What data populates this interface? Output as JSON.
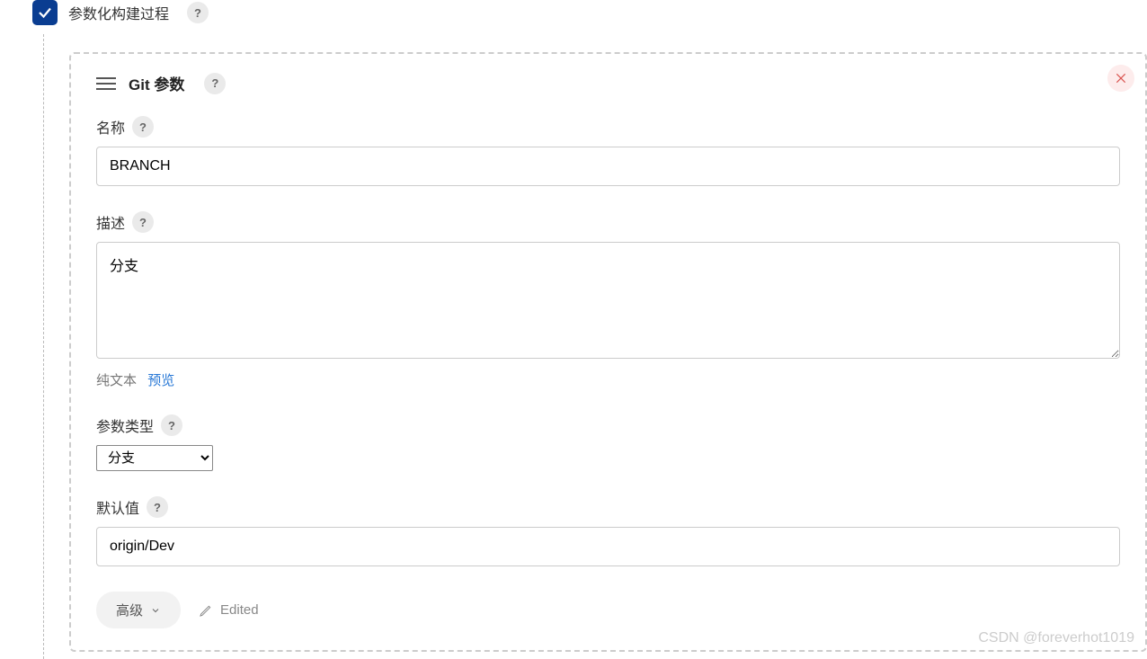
{
  "top_checkbox": {
    "label": "参数化构建过程"
  },
  "block": {
    "title": "Git 参数",
    "name_label": "名称",
    "name_value": "BRANCH",
    "desc_label": "描述",
    "desc_value": "分支",
    "desc_links": {
      "plaintext": "纯文本",
      "preview": "预览"
    },
    "param_type_label": "参数类型",
    "param_type_value": "分支",
    "default_label": "默认值",
    "default_value": "origin/Dev",
    "advanced_label": "高级",
    "edited_label": "Edited"
  },
  "watermark": "CSDN @foreverhot1019"
}
